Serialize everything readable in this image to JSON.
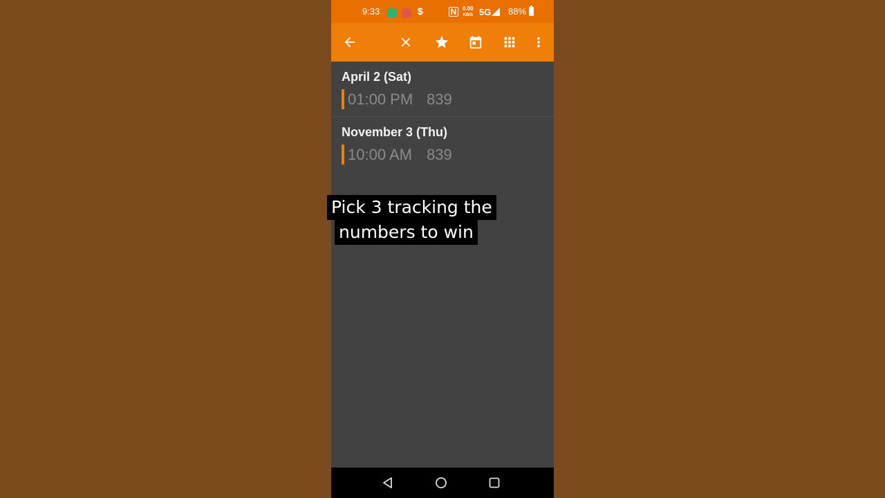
{
  "status_bar": {
    "time": "9:33",
    "notification_icons": [
      "messages-icon",
      "video-icon",
      "dollar-icon"
    ],
    "dollar": "$",
    "nfc": "N",
    "speed_value": "0.00",
    "speed_unit": "KB/S",
    "network": "5G",
    "battery": "88%"
  },
  "toolbar": {
    "icons": [
      "back-arrow-icon",
      "close-icon",
      "star-icon",
      "calendar-icon",
      "grid-icon",
      "more-vert-icon"
    ],
    "background": "#f07f09"
  },
  "results": [
    {
      "date": "April 2 (Sat)",
      "time": "01:00 PM",
      "number": "839"
    },
    {
      "date": "November 3 (Thu)",
      "time": "10:00 AM",
      "number": "839"
    }
  ],
  "caption": {
    "line1": "Pick 3 tracking the",
    "line2": "numbers to win"
  },
  "nav": {
    "icons": [
      "back-triangle-icon",
      "home-circle-icon",
      "recents-square-icon"
    ]
  }
}
